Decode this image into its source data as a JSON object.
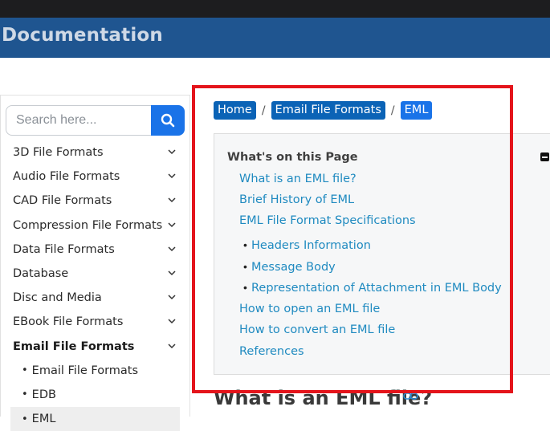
{
  "header": {
    "brand": "Documentation"
  },
  "search": {
    "placeholder": "Search here..."
  },
  "sidebar": {
    "items": [
      {
        "label": "3D File Formats"
      },
      {
        "label": "Audio File Formats"
      },
      {
        "label": "CAD File Formats"
      },
      {
        "label": "Compression File Formats"
      },
      {
        "label": "Data File Formats"
      },
      {
        "label": "Database"
      },
      {
        "label": "Disc and Media"
      },
      {
        "label": "EBook File Formats"
      },
      {
        "label": "Email File Formats"
      }
    ],
    "subitems": [
      {
        "label": "Email File Formats"
      },
      {
        "label": "EDB"
      },
      {
        "label": "EML"
      }
    ]
  },
  "breadcrumb": {
    "home": "Home",
    "section": "Email File Formats",
    "current": "EML"
  },
  "toc": {
    "title": "What's on this Page",
    "links": [
      "What is an EML file?",
      "Brief History of EML",
      "EML File Format Specifications",
      "Headers Information",
      "Message Body",
      "Representation of Attachment in EML Body",
      "How to open an EML file",
      "How to convert an EML file",
      "References"
    ]
  },
  "main": {
    "section_title": "What is an EML file?"
  },
  "colors": {
    "header_bg": "#1f5590",
    "accent": "#1a73e8",
    "breadcrumb_bg": "#0b63b6",
    "toc_link": "#1f8ac0",
    "highlight": "#e4141b"
  }
}
